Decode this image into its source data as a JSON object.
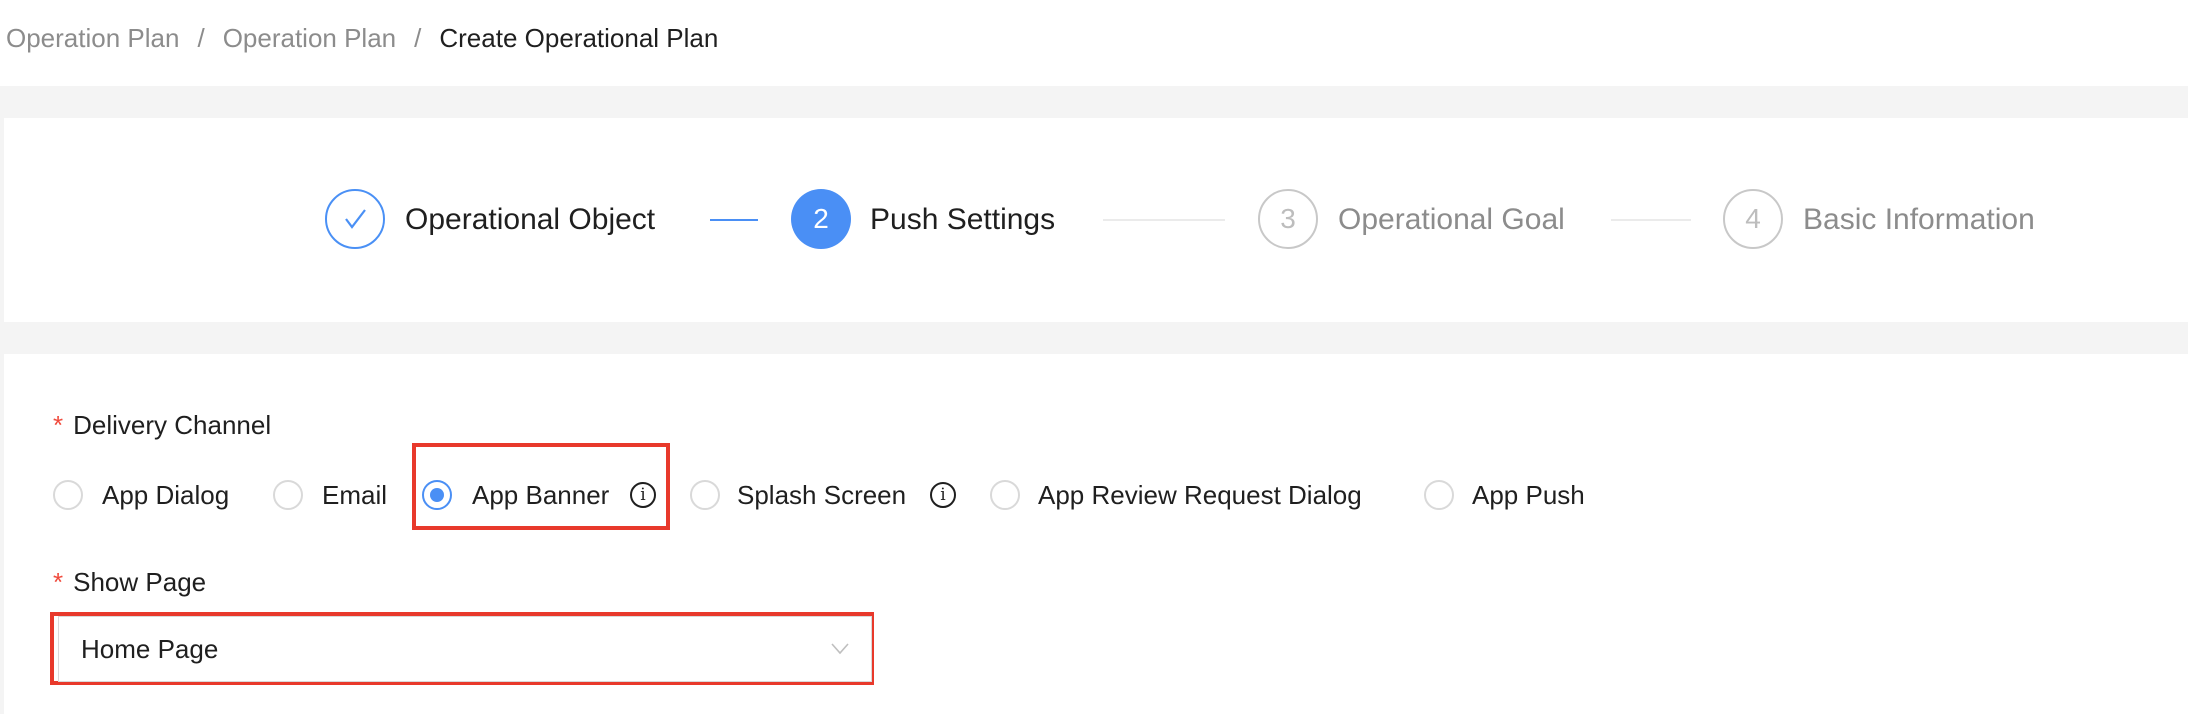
{
  "breadcrumb": [
    "Operation Plan",
    "Operation Plan",
    "Create Operational Plan"
  ],
  "breadcrumb_separator": "/",
  "steps": [
    {
      "number": "1",
      "title": "Operational Object",
      "status": "finished"
    },
    {
      "number": "2",
      "title": "Push Settings",
      "status": "active"
    },
    {
      "number": "3",
      "title": "Operational Goal",
      "status": "waiting"
    },
    {
      "number": "4",
      "title": "Basic Information",
      "status": "waiting"
    }
  ],
  "form": {
    "required_mark": "*",
    "delivery_channel": {
      "label": "Delivery Channel",
      "options": [
        {
          "label": "App Dialog",
          "checked": false,
          "info": false
        },
        {
          "label": "Email",
          "checked": false,
          "info": false
        },
        {
          "label": "App Banner",
          "checked": true,
          "info": true
        },
        {
          "label": "Splash Screen",
          "checked": false,
          "info": true
        },
        {
          "label": "App Review Request Dialog",
          "checked": false,
          "info": false
        },
        {
          "label": "App Push",
          "checked": false,
          "info": false
        }
      ]
    },
    "show_page": {
      "label": "Show Page",
      "value": "Home Page"
    }
  },
  "info_glyph": "i",
  "colors": {
    "accent": "#4a8ff5",
    "highlight": "#e8392b",
    "required": "#f04a3c"
  }
}
